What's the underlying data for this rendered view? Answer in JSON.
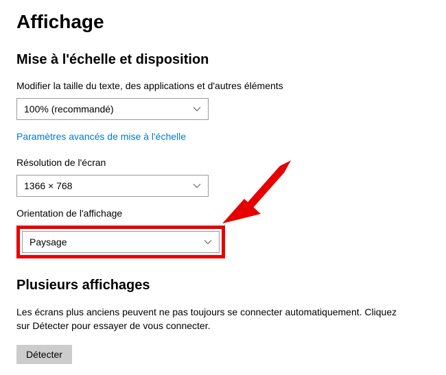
{
  "page": {
    "title": "Affichage"
  },
  "section_scale": {
    "title": "Mise à l'échelle et disposition",
    "text_size_label": "Modifier la taille du texte, des applications et d'autres éléments",
    "scale_value": "100% (recommandé)",
    "advanced_link": "Paramètres avancés de mise à l'échelle",
    "resolution_label": "Résolution de l'écran",
    "resolution_value": "1366 × 768",
    "orientation_label": "Orientation de l'affichage",
    "orientation_value": "Paysage"
  },
  "section_multi": {
    "title": "Plusieurs affichages",
    "description": "Les écrans plus anciens peuvent ne pas toujours se connecter automatiquement. Cliquez sur Détecter pour essayer de vous connecter.",
    "detect_label": "Détecter"
  }
}
